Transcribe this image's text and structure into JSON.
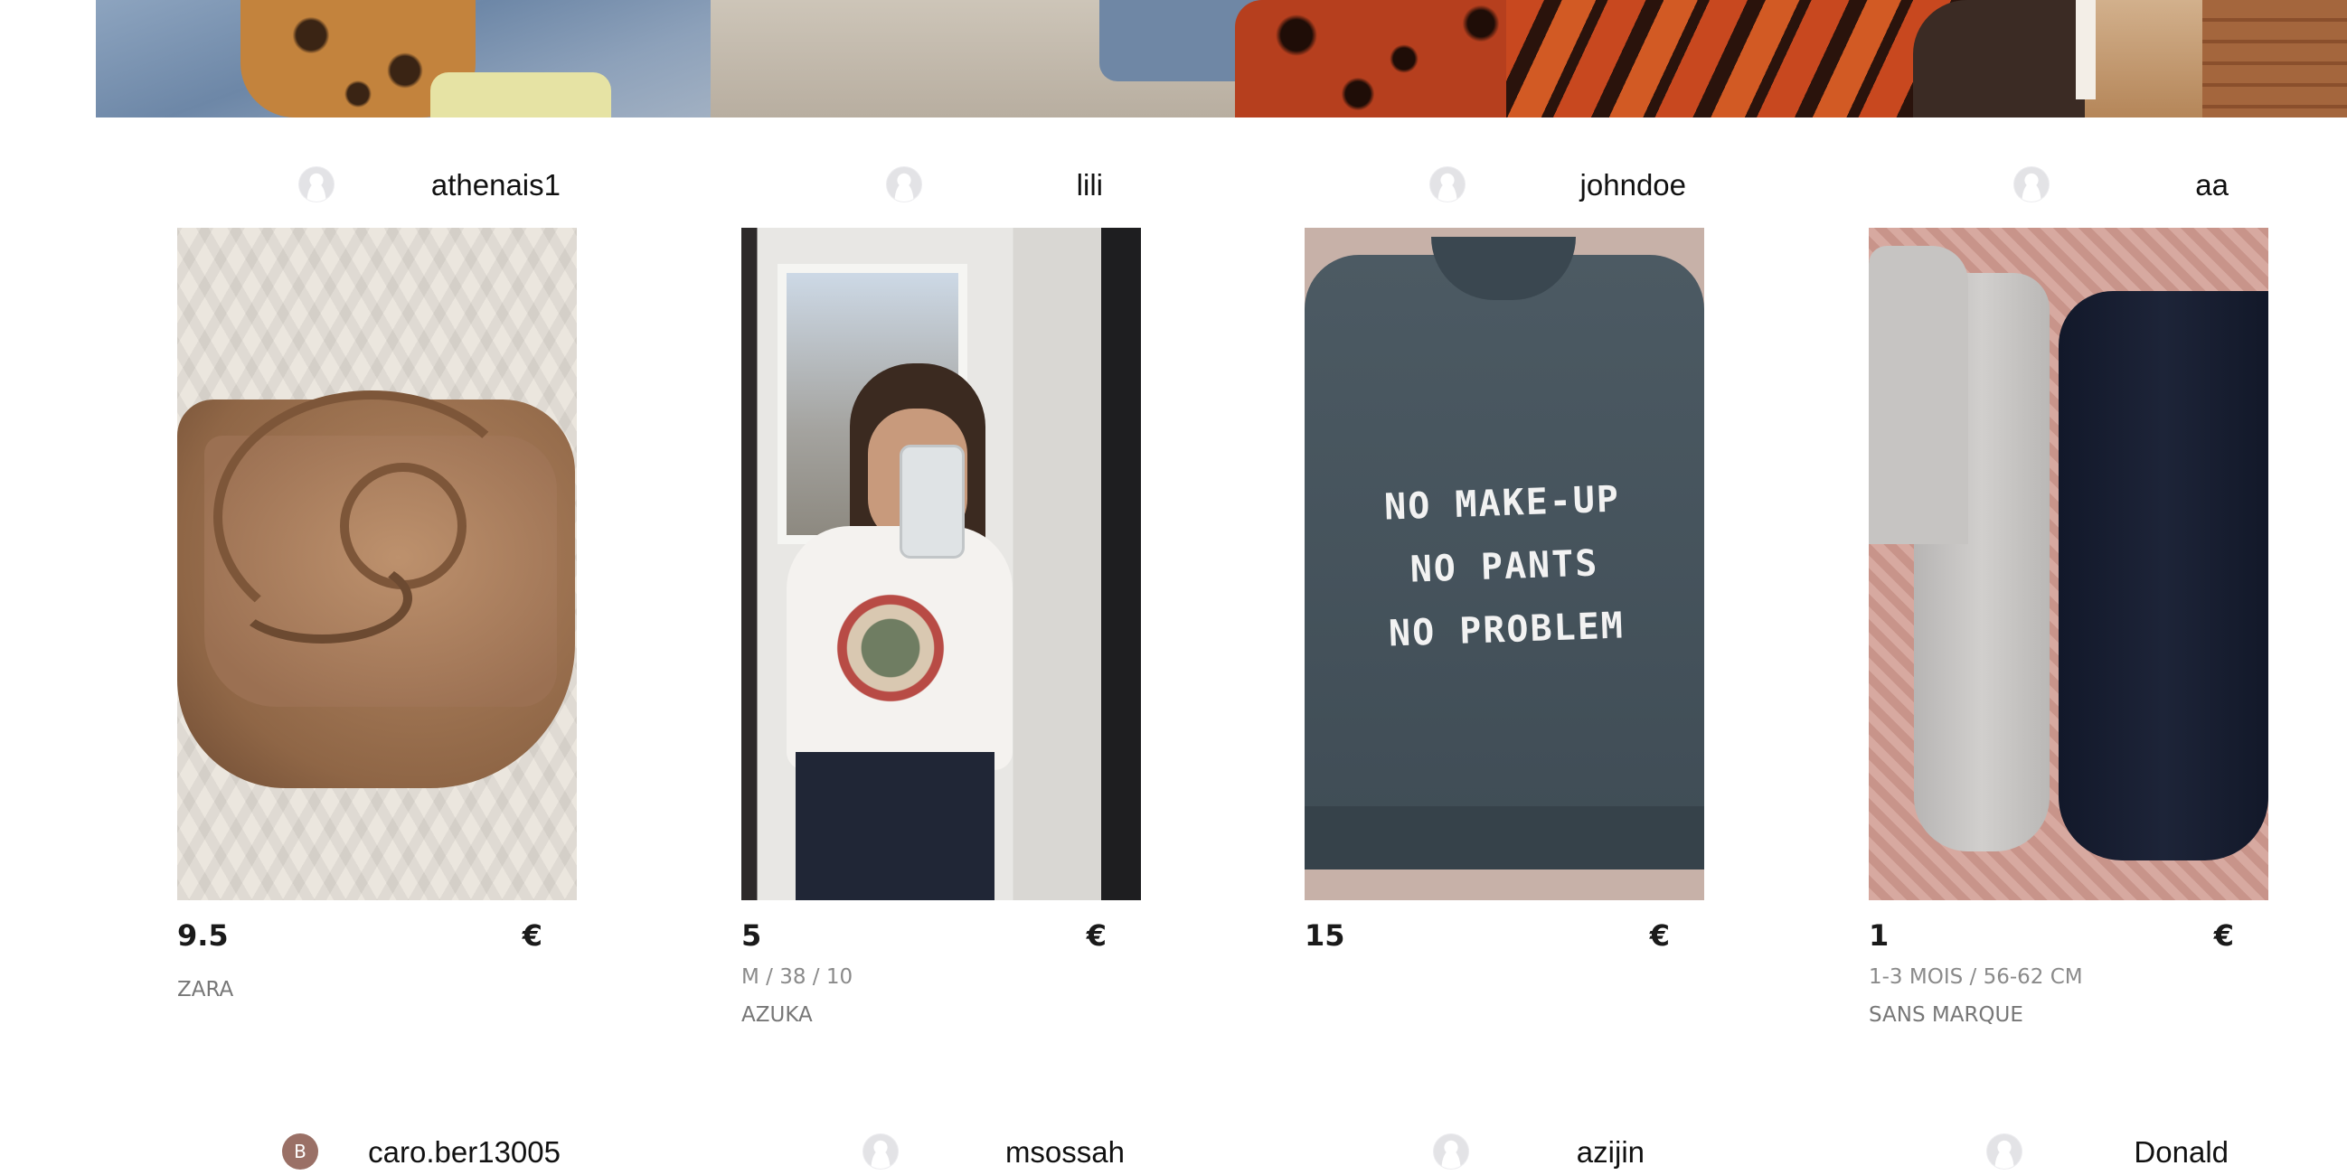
{
  "products": [
    {
      "seller": "athenais1",
      "avatar_letter": "",
      "price": "9.5",
      "currency": "€",
      "size": "",
      "brand": "ZARA",
      "image": "brown-suede-bag-photo"
    },
    {
      "seller": "lili",
      "avatar_letter": "",
      "price": "5",
      "currency": "€",
      "size": "M / 38 / 10",
      "brand": "AZUKA",
      "image": "mirror-selfie-tshirt-photo"
    },
    {
      "seller": "johndoe",
      "avatar_letter": "",
      "price": "15",
      "currency": "€",
      "size": "",
      "brand": "",
      "image": "grey-sweatshirt-photo",
      "slogan": [
        "NO MAKE-UP",
        "NO PANTS",
        "NO PROBLEM"
      ]
    },
    {
      "seller": "aa",
      "avatar_letter": "",
      "price": "1",
      "currency": "€",
      "size": "1-3 MOIS / 56-62 CM",
      "brand": "SANS MARQUE",
      "image": "baby-tights-photo"
    }
  ],
  "next_row_sellers": [
    {
      "seller": "caro.ber13005",
      "avatar_letter": "B"
    },
    {
      "seller": "msossah",
      "avatar_letter": ""
    },
    {
      "seller": "azijin",
      "avatar_letter": ""
    },
    {
      "seller": "Donald",
      "avatar_letter": ""
    }
  ],
  "colors": {
    "avatar_letter_bg": "#9a7066",
    "price_text": "#1a1a1a",
    "meta_text": "#8a8a8a"
  }
}
